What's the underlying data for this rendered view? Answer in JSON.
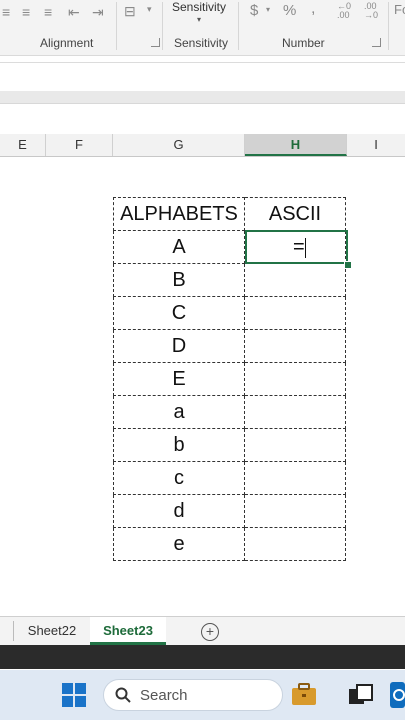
{
  "ribbon": {
    "groups": {
      "alignment": "Alignment",
      "sensitivity": "Sensitivity",
      "number": "Number"
    },
    "sensitivity_button": "Sensitivity",
    "number_symbols": {
      "currency": "$",
      "percent": "%",
      "comma": ","
    },
    "partial_right": "Fo"
  },
  "columns": [
    "E",
    "F",
    "G",
    "H",
    "I"
  ],
  "active_column": "H",
  "table": {
    "headers": [
      "ALPHABETS",
      "ASCII"
    ],
    "rows": [
      "A",
      "B",
      "C",
      "D",
      "E",
      "a",
      "b",
      "c",
      "d",
      "e"
    ]
  },
  "active_cell": {
    "value": "="
  },
  "sheet_tabs": [
    "Sheet22",
    "Sheet23"
  ],
  "active_sheet": "Sheet23",
  "taskbar": {
    "search_placeholder": "Search"
  },
  "colors": {
    "accent": "#217346"
  }
}
